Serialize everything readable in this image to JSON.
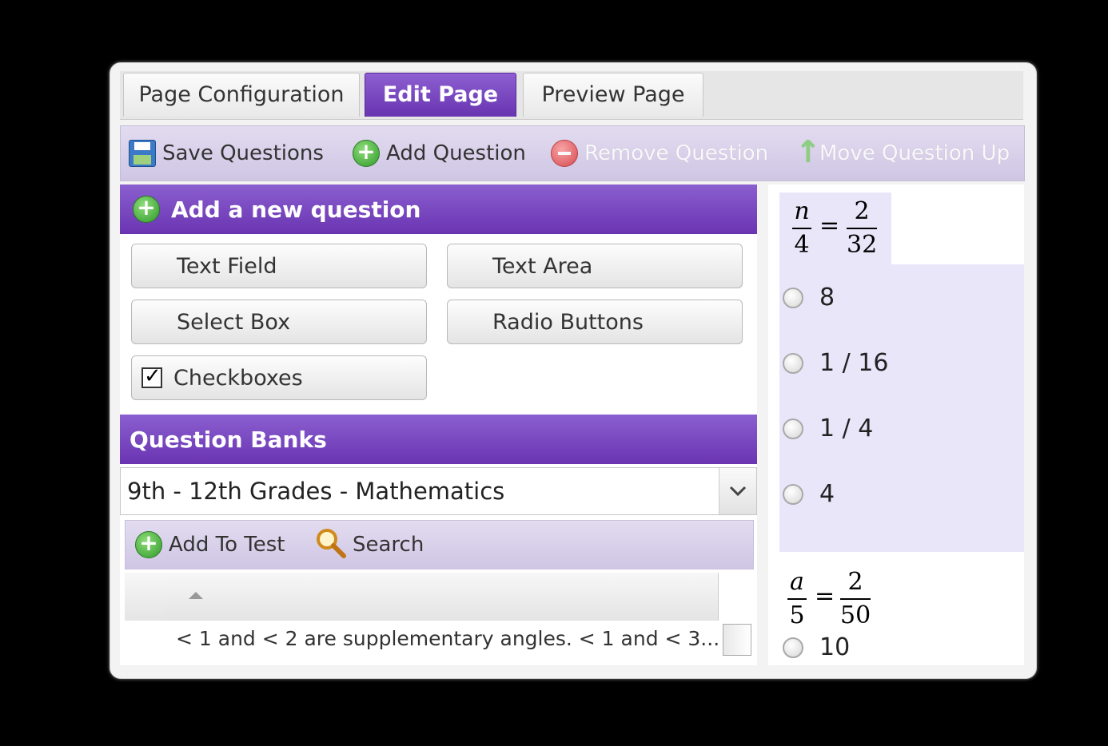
{
  "tabs": [
    {
      "label": "Page Configuration"
    },
    {
      "label": "Edit Page",
      "active": true
    },
    {
      "label": "Preview Page"
    }
  ],
  "toolbar": {
    "save": "Save Questions",
    "add": "Add Question",
    "remove": "Remove Question",
    "move_up": "Move Question Up"
  },
  "new_question": {
    "title": "Add a new question",
    "buttons": [
      "Text Field",
      "Text Area",
      "Select Box",
      "Radio Buttons",
      "Checkboxes"
    ]
  },
  "question_banks": {
    "title": "Question Banks",
    "selected_bank": "9th - 12th Grades - Mathematics",
    "add_to_test": "Add To Test",
    "search": "Search",
    "row_text": "< 1 and < 2 are supplementary angles. < 1 and < 3..."
  },
  "preview": {
    "question1": {
      "lhs_num": "n",
      "lhs_den": "4",
      "rhs_num": "2",
      "rhs_den": "32",
      "equals": "=",
      "options": [
        "8",
        "1 / 16",
        "1 / 4",
        "4"
      ]
    },
    "question2": {
      "lhs_num": "a",
      "lhs_den": "5",
      "rhs_num": "2",
      "rhs_den": "50",
      "equals": "=",
      "options": [
        "10"
      ]
    }
  },
  "colors": {
    "accent": "#7445bf",
    "panel_bg": "#e9e6f9"
  }
}
